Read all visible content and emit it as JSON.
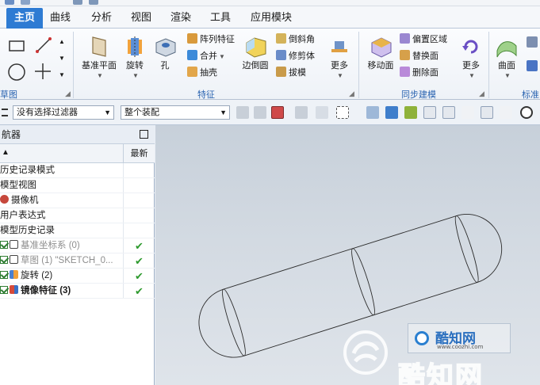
{
  "menu": {
    "tabs": [
      "主页",
      "曲线",
      "分析",
      "视图",
      "渲染",
      "工具",
      "应用模块"
    ],
    "active_tab": "主页"
  },
  "ribbon": {
    "sketch_group_label": "草图",
    "feature_group_label": "特征",
    "sync_group_label": "同步建模",
    "std_group_label": "标准",
    "buttons": {
      "datum_plane": "基准平面",
      "revolve": "旋转",
      "hole": "孔",
      "pattern_feature": "阵列特征",
      "unite": "合并",
      "shell": "抽壳",
      "edge_blend": "边倒圆",
      "chamfer": "倒斜角",
      "trim_body": "修剪体",
      "draft": "拔模",
      "more1": "更多",
      "move_face": "移动面",
      "offset_region": "偏置区域",
      "replace_face": "替换面",
      "delete_face": "删除面",
      "more2": "更多",
      "surface": "曲面"
    }
  },
  "filterbar": {
    "selection_filter": "没有选择过滤器",
    "assembly_scope": "整个装配"
  },
  "navigator": {
    "title": "航器",
    "col_latest": "最新",
    "rows": [
      {
        "text": "历史记录模式",
        "check": ""
      },
      {
        "text": "模型视图",
        "check": ""
      },
      {
        "text": "摄像机",
        "check": ""
      },
      {
        "text": "用户表达式",
        "check": ""
      },
      {
        "text": "模型历史记录",
        "check": ""
      },
      {
        "text": "基准坐标系 (0)",
        "check": "✔"
      },
      {
        "text": "草图 (1) \"SKETCH_0...",
        "check": "✔"
      },
      {
        "text": "旋转 (2)",
        "check": "✔"
      },
      {
        "text": "镜像特征 (3)",
        "check": "✔"
      }
    ]
  },
  "watermark": {
    "brand": "酷知网",
    "site": "www.coozhi.com"
  },
  "colors": {
    "accent": "#2e7bd3",
    "capsule_blue": "#1f86d1",
    "capsule_white": "#f4f6f8",
    "check_green": "#2f9a2f"
  }
}
